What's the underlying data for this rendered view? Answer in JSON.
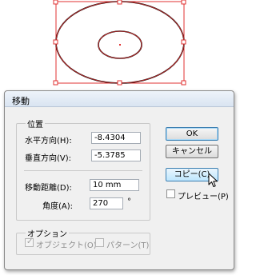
{
  "dialog": {
    "title": "移動",
    "position_group": {
      "label": "位置",
      "horizontal": {
        "label": "水平方向(H):",
        "value": "-8.4304"
      },
      "vertical": {
        "label": "垂直方向(V):",
        "value": "-5.3785"
      },
      "distance": {
        "label": "移動距離(D):",
        "value": "10 mm"
      },
      "angle": {
        "label": "角度(A):",
        "value": "270",
        "unit": "°"
      }
    },
    "options_group": {
      "label": "オプション",
      "object": {
        "label": "オブジェクト(O)",
        "checked": true,
        "enabled": false
      },
      "pattern": {
        "label": "パターン(T)",
        "checked": false,
        "enabled": false
      }
    },
    "buttons": {
      "ok": "OK",
      "cancel": "キャンセル",
      "copy": "コピー(C)"
    },
    "preview": {
      "label": "プレビュー(P)",
      "checked": false
    }
  },
  "colors": {
    "selection": "#e03030",
    "dialog_bg": "#f0f0f0",
    "default_button_border": "#3c7fb1"
  },
  "icons": {
    "cursor": "mouse-pointer-icon",
    "checkmark": "check-icon"
  }
}
